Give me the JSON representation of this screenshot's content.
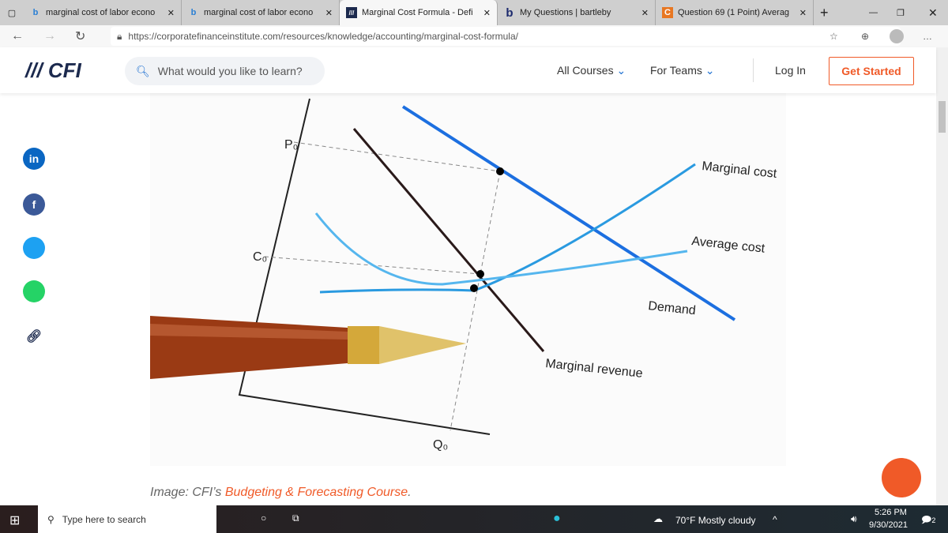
{
  "browser": {
    "tabs": [
      {
        "title": "marginal cost of labor econo",
        "icon": "bing-icon"
      },
      {
        "title": "marginal cost of labor econo",
        "icon": "bing-icon"
      },
      {
        "title": "Marginal Cost Formula - Defi",
        "icon": "cfi-icon",
        "active": true
      },
      {
        "title": "My Questions | bartleby",
        "icon": "bartleby-icon"
      },
      {
        "title": "Question 69 (1 Point) Averag",
        "icon": "chegg-icon"
      }
    ],
    "url": "https://corporatefinanceinstitute.com/resources/knowledge/accounting/marginal-cost-formula/"
  },
  "site": {
    "logo": "CFI",
    "search_placeholder": "What would you like to learn?",
    "menu": [
      "All Courses",
      "For Teams"
    ],
    "login": "Log In",
    "cta": "Get Started",
    "accent": "#f05a28"
  },
  "social": [
    "in",
    "f",
    "t",
    "w",
    "link"
  ],
  "figure": {
    "labels": {
      "p0": "P₀",
      "c0": "C₀",
      "q0": "Q₀",
      "mc": "Marginal cost",
      "ac": "Average cost",
      "demand": "Demand",
      "mr": "Marginal revenue"
    }
  },
  "caption": {
    "prefix": "Image: CFI’s ",
    "link": "Budgeting & Forecasting Course",
    "suffix": "."
  },
  "taskbar": {
    "search": "Type here to search",
    "weather": "70°F  Mostly cloudy",
    "time": "5:26 PM",
    "date": "9/30/2021",
    "notifications": "2"
  }
}
